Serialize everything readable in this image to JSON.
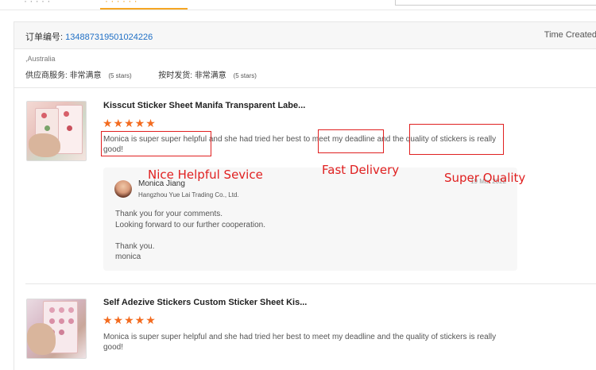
{
  "top_nav": {
    "tabs": [
      {
        "label": "· · · · ·"
      },
      {
        "label": "· · · · · ·"
      }
    ]
  },
  "order": {
    "order_no_label": "订单编号:",
    "order_no": "134887319501024226",
    "time_created_label": "Time Created"
  },
  "buyer": {
    "country": ",Australia",
    "ratings": [
      {
        "label": "供应商服务:",
        "value": "非常满意",
        "stars": "(5 stars)"
      },
      {
        "label": "按时发货:",
        "value": "非常满意",
        "stars": "(5 stars)"
      }
    ]
  },
  "reviews": [
    {
      "product_title": "Kisscut Sticker Sheet Manifa Transparent Labe...",
      "stars": "★★★★★",
      "text": "Monica is super super helpful and she had tried her best to meet my deadline and the quality of stickers is really good!",
      "reply": {
        "name": "Monica Jiang",
        "company": "Hangzhou Yue Lai Trading Co., Ltd.",
        "date": "19 Mar 2022",
        "text": "Thank you for your comments.\nLooking forward to our further cooperation.\n\nThank you.\nmonica"
      }
    },
    {
      "product_title": "Self Adezive Stickers Custom Sticker Sheet Kis...",
      "stars": "★★★★★",
      "text": "Monica is super super helpful and she had tried her best to meet my deadline and the quality of stickers is really good!"
    }
  ],
  "annotations": [
    {
      "label": "Nice Helpful Sevice"
    },
    {
      "label": "Fast Delivery"
    },
    {
      "label": "Super Quality"
    }
  ],
  "colors": {
    "accent_orange": "#f36b1f",
    "link_blue": "#1f6fc5",
    "annotation_red": "#e02020"
  }
}
